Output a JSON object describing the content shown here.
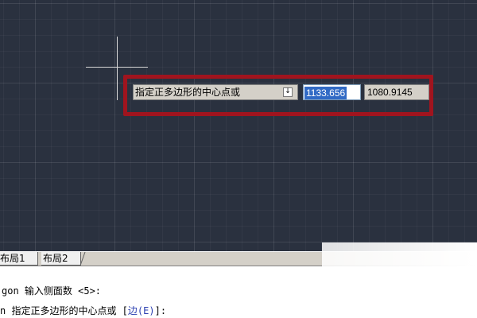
{
  "canvas": {
    "background_color": "#2a313f",
    "grid_color": "#3a4150"
  },
  "dynamic_input": {
    "prompt": "指定正多边形的中心点或",
    "options_icon": "down-arrow-icon",
    "options_glyph": "↓",
    "x_value": "1133.656",
    "y_value": "1080.9145",
    "highlight_color": "#a0141e"
  },
  "layout_tabs": [
    {
      "label": "布局1"
    },
    {
      "label": "布局2"
    }
  ],
  "command_history": {
    "line1": "gon 输入侧面数 <5>:",
    "line2_prefix": "n 指定正多边形的中心点或 [",
    "line2_option": "边(E)",
    "line2_suffix": "]:"
  }
}
